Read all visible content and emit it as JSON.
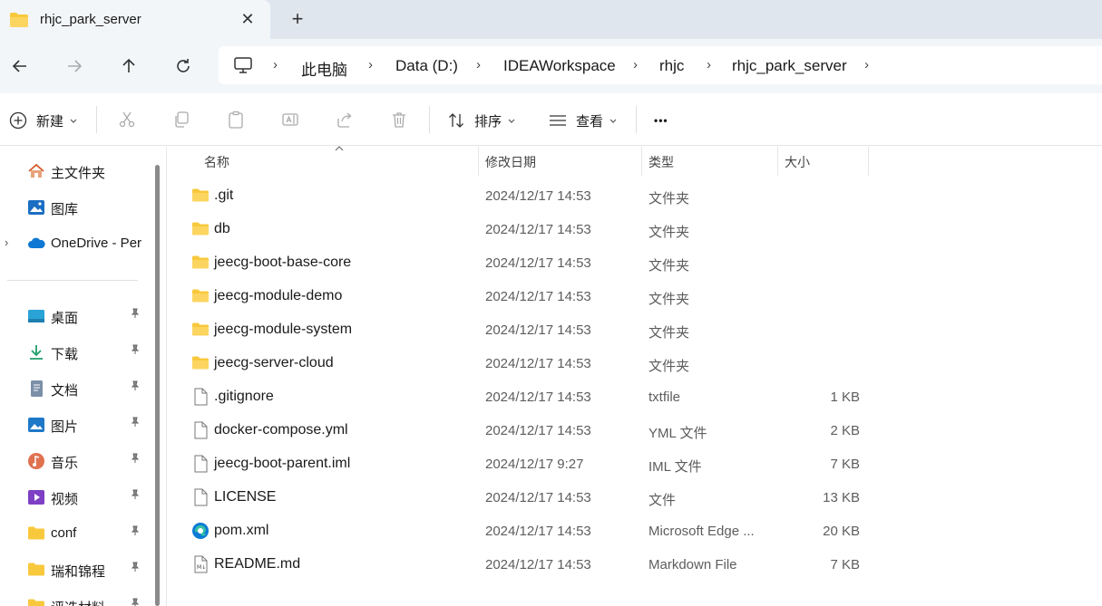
{
  "tab": {
    "title": "rhjc_park_server",
    "close_glyph": "✕",
    "new_tab_glyph": "+"
  },
  "nav": {
    "breadcrumb": [
      "此电脑",
      "Data (D:)",
      "IDEAWorkspace",
      "rhjc",
      "rhjc_park_server"
    ],
    "separator": "›"
  },
  "toolbar": {
    "new_label": "新建",
    "sort_label": "排序",
    "view_label": "查看",
    "more_glyph": "•••"
  },
  "sidebar": {
    "top": [
      {
        "label": "主文件夹",
        "icon": "home-icon"
      },
      {
        "label": "图库",
        "icon": "gallery-icon"
      },
      {
        "label": "OneDrive - Per",
        "icon": "onedrive-icon"
      }
    ],
    "quick": [
      {
        "label": "桌面",
        "icon": "desktop-icon"
      },
      {
        "label": "下载",
        "icon": "download-icon"
      },
      {
        "label": "文档",
        "icon": "document-icon"
      },
      {
        "label": "图片",
        "icon": "pictures-icon"
      },
      {
        "label": "音乐",
        "icon": "music-icon"
      },
      {
        "label": "视频",
        "icon": "video-icon"
      },
      {
        "label": "conf",
        "icon": "folder-icon"
      },
      {
        "label": "瑞和锦程",
        "icon": "folder-icon"
      },
      {
        "label": "评选材料",
        "icon": "folder-icon"
      }
    ],
    "pin_glyph": "📌",
    "expander_glyph": "›"
  },
  "columns": {
    "name": "名称",
    "date": "修改日期",
    "type": "类型",
    "size": "大小"
  },
  "files": [
    {
      "name": ".git",
      "date": "2024/12/17 14:53",
      "type": "文件夹",
      "size": "",
      "icon": "folder-icon"
    },
    {
      "name": "db",
      "date": "2024/12/17 14:53",
      "type": "文件夹",
      "size": "",
      "icon": "folder-icon"
    },
    {
      "name": "jeecg-boot-base-core",
      "date": "2024/12/17 14:53",
      "type": "文件夹",
      "size": "",
      "icon": "folder-icon"
    },
    {
      "name": "jeecg-module-demo",
      "date": "2024/12/17 14:53",
      "type": "文件夹",
      "size": "",
      "icon": "folder-icon"
    },
    {
      "name": "jeecg-module-system",
      "date": "2024/12/17 14:53",
      "type": "文件夹",
      "size": "",
      "icon": "folder-icon"
    },
    {
      "name": "jeecg-server-cloud",
      "date": "2024/12/17 14:53",
      "type": "文件夹",
      "size": "",
      "icon": "folder-icon"
    },
    {
      "name": ".gitignore",
      "date": "2024/12/17 14:53",
      "type": "txtfile",
      "size": "1 KB",
      "icon": "file-icon"
    },
    {
      "name": "docker-compose.yml",
      "date": "2024/12/17 14:53",
      "type": "YML 文件",
      "size": "2 KB",
      "icon": "file-icon"
    },
    {
      "name": "jeecg-boot-parent.iml",
      "date": "2024/12/17 9:27",
      "type": "IML 文件",
      "size": "7 KB",
      "icon": "file-icon"
    },
    {
      "name": "LICENSE",
      "date": "2024/12/17 14:53",
      "type": "文件",
      "size": "13 KB",
      "icon": "file-icon"
    },
    {
      "name": "pom.xml",
      "date": "2024/12/17 14:53",
      "type": "Microsoft Edge ...",
      "size": "20 KB",
      "icon": "edge-icon"
    },
    {
      "name": "README.md",
      "date": "2024/12/17 14:53",
      "type": "Markdown File",
      "size": "7 KB",
      "icon": "markdown-icon"
    }
  ],
  "colors": {
    "folder": "#f8c93c",
    "accent": "#0067c0",
    "tab_bg": "#dfe6ee"
  }
}
